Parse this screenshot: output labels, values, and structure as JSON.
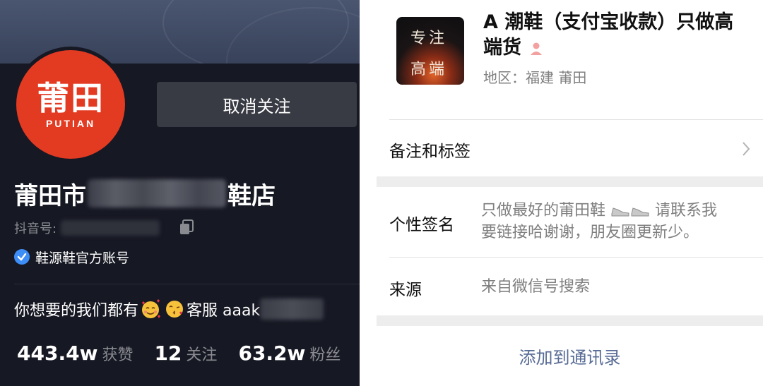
{
  "left": {
    "avatar_cn": "莆田",
    "avatar_en": "PUTIAN",
    "unfollow_label": "取消关注",
    "shop_prefix": "莆田市",
    "shop_suffix": "鞋店",
    "douyin_id_label": "抖音号:",
    "verified_label": "鞋源鞋官方账号",
    "bio_text": "你想要的我们都有",
    "bio_service": "客服 aaak",
    "stats": [
      {
        "num": "443.4w",
        "label": "获赞"
      },
      {
        "num": "12",
        "label": "关注"
      },
      {
        "num": "63.2w",
        "label": "粉丝"
      }
    ],
    "colors": {
      "bg": "#161823",
      "brand_red": "#e33a22",
      "verified_blue": "#3e8ef7"
    }
  },
  "right": {
    "thumb_text": [
      "专注",
      "高端"
    ],
    "contact_name": "A 潮鞋（支付宝收款）只做高端货",
    "region": "地区：福建 莆田",
    "remark_label": "备注和标签",
    "signature_label": "个性签名",
    "signature_line1": "只做最好的莆田鞋",
    "signature_line1b": "请联系我",
    "signature_line2": "要链接哈谢谢，朋友圈更新少。",
    "source_label": "来源",
    "source_value": "来自微信号搜索",
    "add_contact": "添加到通讯录",
    "colors": {
      "link": "#576b95",
      "bg": "#ededed"
    }
  }
}
